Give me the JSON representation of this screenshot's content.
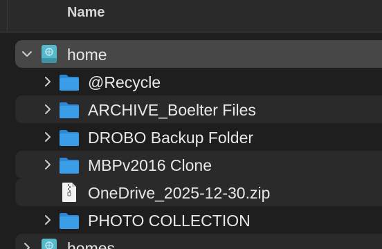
{
  "column_header": {
    "name": "Name"
  },
  "rows": [
    {
      "label": "home",
      "kind": "volume",
      "expanded": true,
      "selected": true
    },
    {
      "label": "@Recycle",
      "kind": "folder",
      "expanded": false
    },
    {
      "label": "ARCHIVE_Boelter Files",
      "kind": "folder",
      "expanded": false
    },
    {
      "label": "DROBO Backup Folder",
      "kind": "folder",
      "expanded": false
    },
    {
      "label": "MBPv2016 Clone",
      "kind": "folder",
      "expanded": false
    },
    {
      "label": "OneDrive_2025-12-30.zip",
      "kind": "zip-file"
    },
    {
      "label": "PHOTO COLLECTION",
      "kind": "folder",
      "expanded": false
    },
    {
      "label": "homes",
      "kind": "volume",
      "expanded": false
    }
  ],
  "colors": {
    "folder": "#3b9ce8",
    "volume": "#56b8c9",
    "selection": "#474747",
    "stripe": "#2a2a2a"
  }
}
